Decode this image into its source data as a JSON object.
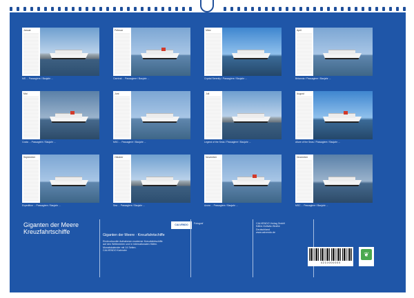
{
  "calendar": {
    "title_line1": "Giganten der Meere",
    "title_line2": "Kreuzfahrtschiffe",
    "months": [
      {
        "name": "Januar",
        "caption": "MS ... Passagiere / Baujahr ..."
      },
      {
        "name": "Februar",
        "caption": "Carnival ... Passagiere / Baujahr ..."
      },
      {
        "name": "März",
        "caption": "Crystal Serenity / Passagiere / Baujahr ..."
      },
      {
        "name": "April",
        "caption": "Britannia / Passagiere / Baujahr ..."
      },
      {
        "name": "Mai",
        "caption": "Costa ... Passagiere / Baujahr ..."
      },
      {
        "name": "Juni",
        "caption": "MSC ... Passagiere / Baujahr ..."
      },
      {
        "name": "Juli",
        "caption": "Legend of the Seas / Passagiere / Baujahr ..."
      },
      {
        "name": "August",
        "caption": "Allure of the Seas / Passagiere / Baujahr ..."
      },
      {
        "name": "September",
        "caption": "Expedition ... Passagiere / Baujahr ..."
      },
      {
        "name": "Oktober",
        "caption": "Sea ... Passagiere / Baujahr ..."
      },
      {
        "name": "November",
        "caption": "Azura ... Passagiere / Baujahr ..."
      },
      {
        "name": "Dezember",
        "caption": "MSC ... Passagiere / Baujahr ..."
      }
    ],
    "info": {
      "subtitle_label": "Giganten der Meere · Kreuzfahrtschiffe",
      "desc_lines": [
        "Eindrucksvolle Aufnahmen moderner Kreuzfahrtschiffe",
        "auf den Weltmeeren und in internationalen Häfen.",
        "Monatskalender mit 14 Seiten.",
        "CALVENDO Kalender"
      ],
      "logo": "CALVENDO",
      "author_label": "Fotograf",
      "publisher_lines": [
        "CALVENDO Verlag GmbH",
        "Käthe-Kollwitz-Straße",
        "Deutschland"
      ],
      "copyright": "www.calvendo.de"
    },
    "barcode_number": "4 2 1 0 0 0 0 0 0 0"
  }
}
